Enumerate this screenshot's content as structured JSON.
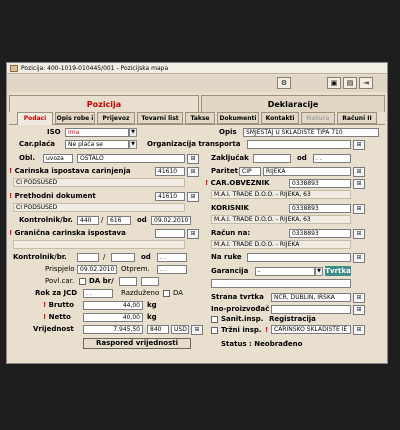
{
  "window_title": "Pozicija: 400-1019-010445/001 - Pozicijska mapa",
  "sections": {
    "left": "Pozicija",
    "right": "Deklaracije"
  },
  "tabs": [
    "Podaci",
    "Opis robe i",
    "Prijevoz",
    "Tovarni list",
    "Takse",
    "Dokumenti",
    "Kontakti",
    "Natura",
    "Računi II"
  ],
  "labels": {
    "iso": "ISO",
    "opis": "Opis",
    "car_placa": "Car.plaća",
    "org_transporta": "Organizacija transporta",
    "obl": "Obl.",
    "zakljucak": "Zaključak",
    "od": "od",
    "carinska_isp": "Carinska ispostava carinjenja",
    "paritet": "Paritet",
    "prethodni": "Prethodni dokument",
    "car_obveznik": "CAR.OBVEZNIK",
    "korisnik": "KORISNIK",
    "kontrolnik": "Kontrolnik/br.",
    "granicna": "Granična carinska ispostava",
    "racun_na": "Račun na:",
    "na_ruke": "Na ruke",
    "kontrolnik2": "Kontrolnik/br.",
    "prispjelo": "Prispjelo",
    "otprem": "Otprem.",
    "povl_car": "Povl.car.",
    "da_br": "DA  br/",
    "garancija": "Garancija",
    "rok_jcd": "Rok za JCD",
    "razduzeno": "Razduženo",
    "da": "DA",
    "strana_tvrtka": "Strana tvrtka",
    "brutto": "Brutto",
    "kg1": "kg",
    "ino_proizvodac": "Ino-proizvođač",
    "netto": "Netto",
    "kg2": "kg",
    "sanit": "Sanit.insp.",
    "trzni": "Tržni insp.",
    "registracija": "Registracija",
    "vrijednost": "Vrijednost",
    "status": "Status : Neobrađeno"
  },
  "fields": {
    "iso": "Ima",
    "opis": "SMJEŠTAJ U SKLADIŠTE TIPA 710",
    "car_placa": "Ne plaća se",
    "obl": "uvoza",
    "obl_val": "OSTALO",
    "zakljucak": "",
    "zakljucak_date": ". .",
    "carinska_code": "41610",
    "carinska_name": "CI PODSUSED",
    "paritet_code": "CIP",
    "paritet_name": "RIJEKA",
    "prethodni_code": "41610",
    "prethodni_name": "CI PODSUSED",
    "car_obv_code": "0338893",
    "car_obv_name": "M.A.I. TRADE D.O.O. - RIJEKA, 63",
    "korisnik_code": "0338893",
    "korisnik_name": "M.A.I. TRADE D.O.O. - RIJEKA, 63",
    "kontrolnik_a": "440",
    "kontrolnik_b": "616",
    "kontrolnik_date": "09.02.2010",
    "racun_code": "0338893",
    "racun_name": "M.A.I. TRADE D.O.O. - RIJEKA",
    "kontrolnik2_sep": "/",
    "kontrolnik2_date": ". .",
    "prispjelo": "09.02.2010",
    "otprem": ". .",
    "garancija": "-",
    "tvrtka_btn": "Tvrtka",
    "rok_jcd": ". .",
    "strana_tvrtka": "NCR, DUBLIN, IRSKA",
    "brutto": "44,00",
    "netto": "40,00",
    "registracija": "CARINSKO SKLADIŠTE IE",
    "vrijednost": "7.945,50",
    "vrijednost_num": "840",
    "currency": "USD",
    "raspored_btn": "Raspored vrijednosti"
  },
  "colors": {
    "required": "#e00000",
    "tvrtka": "#3c8c88",
    "tab_active": "#cc0000"
  },
  "icons": [
    "window-icon",
    "lock-icon",
    "save-icon",
    "print-icon",
    "exit-icon",
    "lookup-icon"
  ]
}
